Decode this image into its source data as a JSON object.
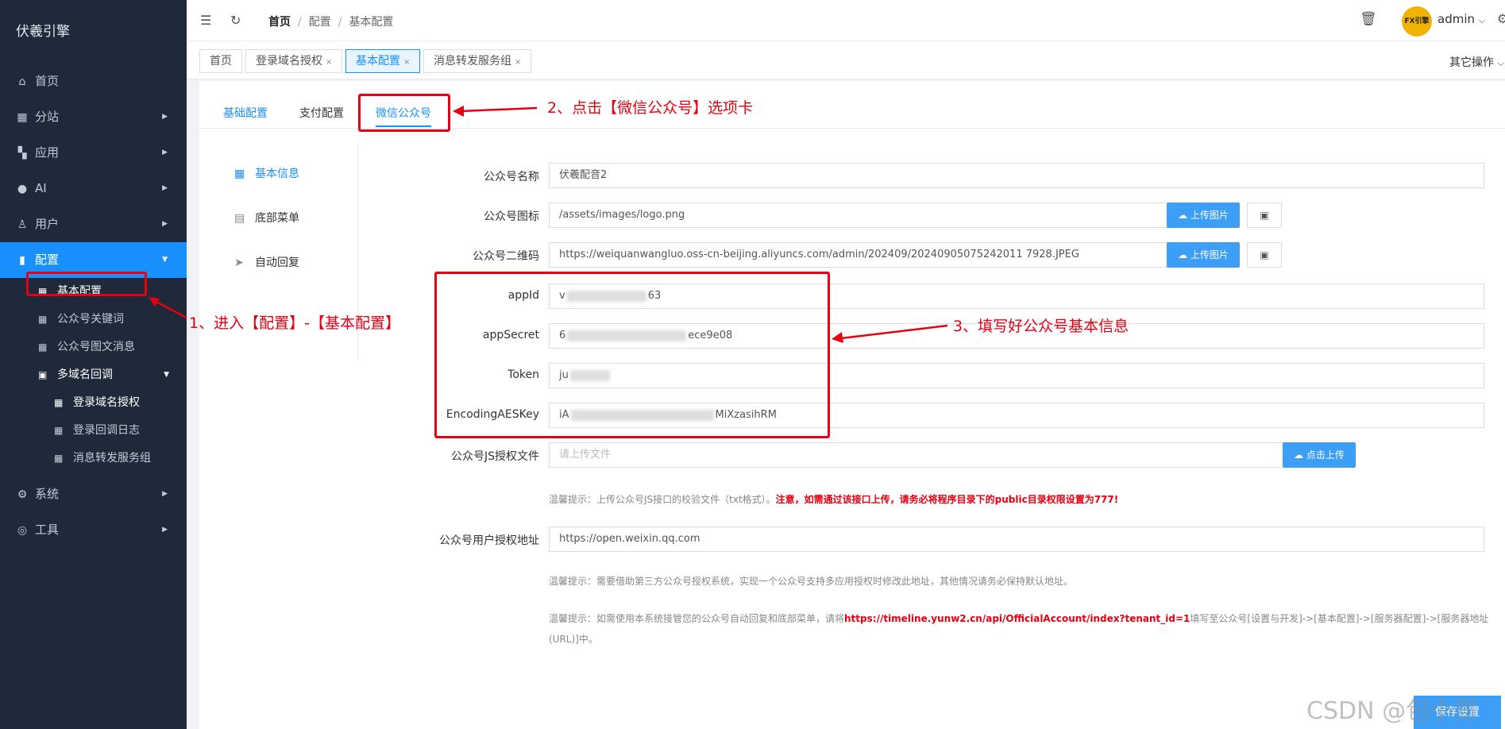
{
  "sidebar": {
    "brand": "伏羲引擎",
    "items": [
      {
        "label": "首页",
        "icon": "home-icon"
      },
      {
        "label": "分站",
        "icon": "building-icon"
      },
      {
        "label": "应用",
        "icon": "grid-icon"
      },
      {
        "label": "AI",
        "icon": "bulb-icon"
      },
      {
        "label": "用户",
        "icon": "user-icon"
      },
      {
        "label": "配置",
        "icon": "chart-icon"
      },
      {
        "label": "系统",
        "icon": "gear-icon"
      },
      {
        "label": "工具",
        "icon": "tool-icon"
      }
    ],
    "config_sub": [
      "基本配置",
      "公众号关键词",
      "公众号图文消息",
      "多域名回调"
    ],
    "callback_sub": [
      "登录域名授权",
      "登录回调日志",
      "消息转发服务组"
    ]
  },
  "topbar": {
    "breadcrumb": [
      "首页",
      "配置",
      "基本配置"
    ],
    "username": "admin",
    "avatar_text": "FX引擎"
  },
  "tabs": [
    "首页",
    "登录域名授权",
    "基本配置",
    "消息转发服务组"
  ],
  "tab_close": "×",
  "other_ops": "其它操作",
  "subtabs": [
    "基础配置",
    "支付配置",
    "微信公众号"
  ],
  "leftnav": [
    "基本信息",
    "底部菜单",
    "自动回复"
  ],
  "form": {
    "name_label": "公众号名称",
    "name_value": "伏羲配音2",
    "icon_label": "公众号图标",
    "icon_value": "/assets/images/logo.png",
    "qrcode_label": "公众号二维码",
    "qrcode_value": "https://weiquanwangluo.oss-cn-beijing.aliyuncs.com/admin/202409/20240905075242011 7928.JPEG",
    "upload_btn": "上传图片",
    "appid_label": "appId",
    "appid_start": "v",
    "appid_end": "63",
    "secret_label": "appSecret",
    "secret_start": "6",
    "secret_end": "ece9e08",
    "token_label": "Token",
    "token_start": "ju",
    "aes_label": "EncodingAESKey",
    "aes_start": "iA",
    "aes_end": "MiXzasihRM",
    "js_label": "公众号JS授权文件",
    "js_placeholder": "请上传文件",
    "js_btn": "点击上传",
    "js_hint_prefix": "温馨提示：上传公众号JS接口的校验文件（txt格式）。",
    "js_hint_warn": "注意，如需通过该接口上传，请务必将程序目录下的public目录权限设置为777!",
    "auth_label": "公众号用户授权地址",
    "auth_value": "https://open.weixin.qq.com",
    "auth_hint": "温馨提示：需要借助第三方公众号授权系统，实现一个公众号支持多应用授权时修改此地址，其他情况请务必保持默认地址。",
    "server_hint_prefix": "温馨提示：如需使用本系统接管您的公众号自动回复和底部菜单，请将",
    "server_hint_url": "https://timeline.yunw2.cn/api/OfficialAccount/index?tenant_id=1",
    "server_hint_suffix": "填写至公众号[设置与开发]->[基本配置]->[服务器配置]->[服务器地址",
    "server_hint_line2": "(URL)]中。",
    "save_btn": "保存设置"
  },
  "annotations": {
    "step1": "1、进入【配置】-【基本配置】",
    "step2": "2、点击【微信公众号】选项卡",
    "step3": "3、填写好公众号基本信息",
    "color": "#e60012"
  },
  "watermark": "CSDN @包小哥",
  "colors": {
    "sidebar": "#1e2a3a",
    "accent": "#1890ff",
    "danger": "#e60012"
  }
}
